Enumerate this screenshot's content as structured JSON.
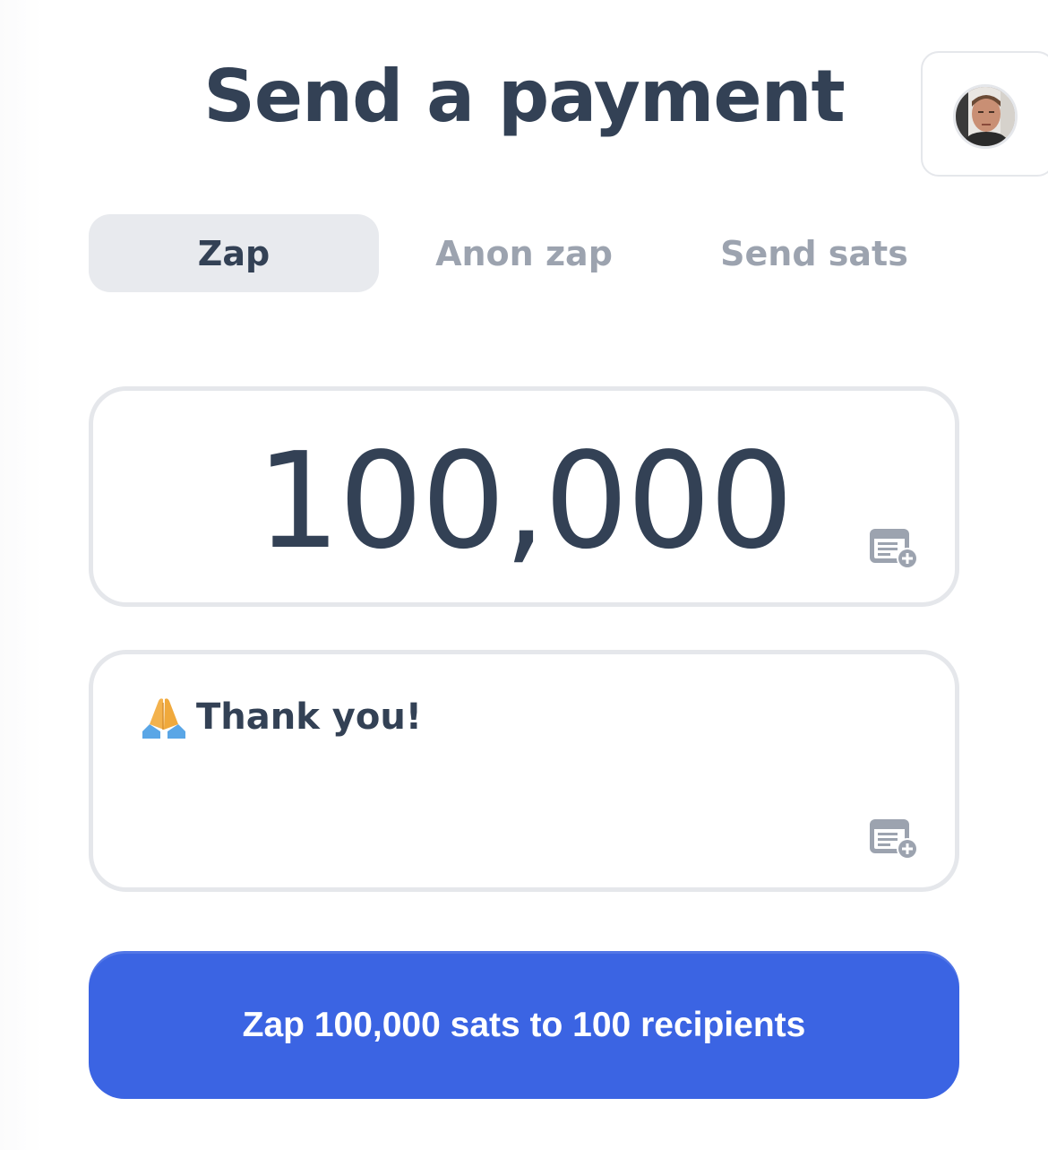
{
  "header": {
    "title": "Send a payment"
  },
  "profile": {
    "avatar_alt": "avatar"
  },
  "tabs": [
    {
      "label": "Zap",
      "active": true
    },
    {
      "label": "Anon zap",
      "active": false
    },
    {
      "label": "Send sats",
      "active": false
    }
  ],
  "amount": {
    "value": "100,000",
    "icon": "add-note-icon"
  },
  "note": {
    "emoji": "folded-hands",
    "text": "Thank you!",
    "icon": "add-note-icon"
  },
  "submit": {
    "label": "Zap 100,000 sats to 100 recipients"
  },
  "colors": {
    "accent": "#3b64e3",
    "text": "#334155",
    "muted": "#9ca3af",
    "border": "#e5e7eb",
    "active_tab_bg": "#e8eaee"
  }
}
